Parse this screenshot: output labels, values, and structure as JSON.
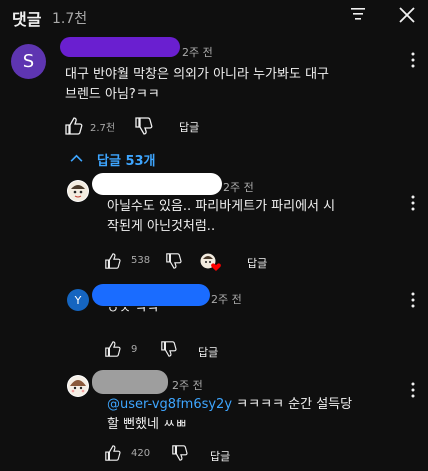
{
  "header": {
    "title": "댓글",
    "count": "1.7천"
  },
  "top_comment": {
    "avatar_letter": "S",
    "avatar_color": "#5e35b1",
    "author_redaction_color": "#6a1fd0",
    "time": "2주 전",
    "text_line1": "대구 반야월 막창은 의외가 아니라 누가봐도 대구",
    "text_line2": "브렌드 아님?ㅋㅋ",
    "likes": "2.7천",
    "reply_label": "답글",
    "replies_toggle": "답글 53개"
  },
  "replies": [
    {
      "time": "2주 전",
      "author_redaction_color": "#ffffff",
      "text_line1": "아닐수도 있음.. 파리바게트가 파리에서 시",
      "text_line2": "작된게 아닌것처럼..",
      "likes": "538",
      "reply_label": "답글"
    },
    {
      "avatar_letter": "Y",
      "avatar_color": "#1565c0",
      "author_redaction_color": "#1a6cff",
      "time": "2주 전",
      "text_line1": "ㅇㅈ ㅋㅋ",
      "likes": "9",
      "reply_label": "답글"
    },
    {
      "time": "2주 전",
      "author_redaction_color": "#9e9e9e",
      "mention": "@user-vg8fm6sy2y",
      "text_rest": " ㅋㅋㅋㅋ 순간 설득당",
      "text_line2": "할 뻔했네 ㅆㅃ",
      "likes": "420",
      "reply_label": "답글"
    }
  ],
  "icons": {
    "filter": "filter-icon",
    "close": "close-icon",
    "like": "thumbs-up-icon",
    "dislike": "thumbs-down-icon",
    "more": "more-vertical-icon",
    "chevron": "chevron-up-icon",
    "heart": "creator-heart-icon"
  }
}
